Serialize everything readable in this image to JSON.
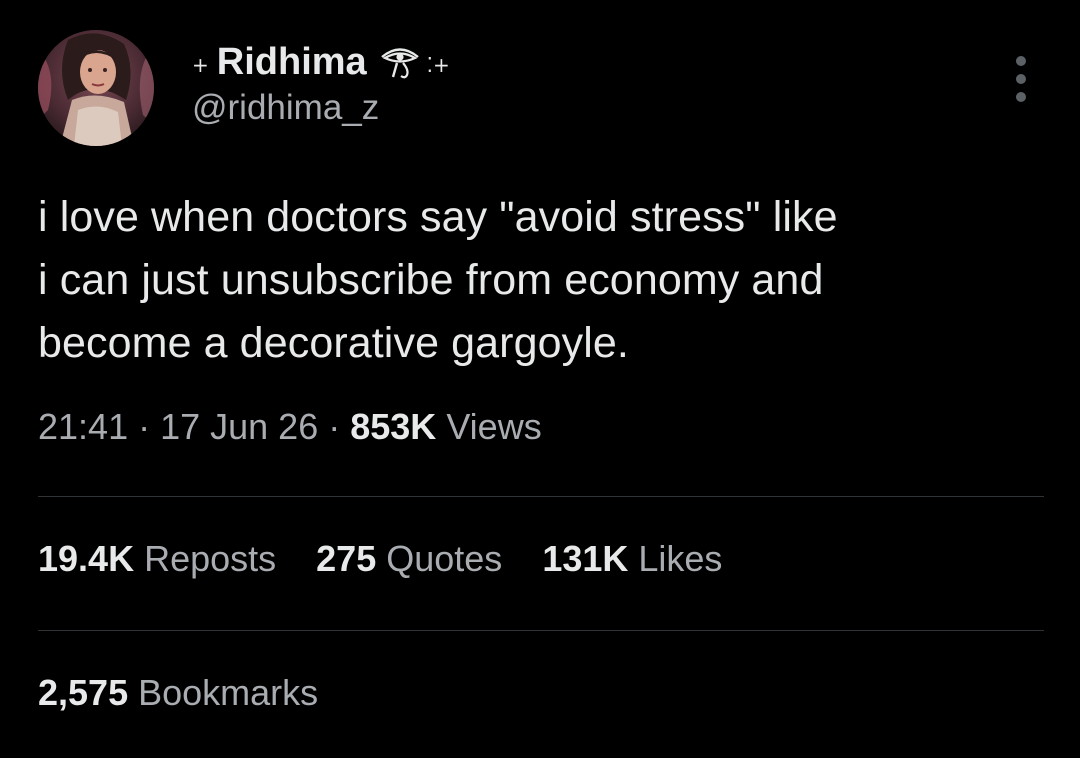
{
  "user": {
    "deco_left": "+",
    "display_name": "Ridhima",
    "deco_right": "⁚+",
    "handle": "@ridhima_z",
    "verified_icon": "eye-of-horus-icon"
  },
  "tweet": {
    "text_lines": [
      "i love when doctors say \"avoid stress\" like",
      "i can just unsubscribe from economy and",
      "become a decorative gargoyle."
    ],
    "time": "21:41",
    "date": "17 Jun 26",
    "separator": "·",
    "views_count": "853K",
    "views_label": "Views"
  },
  "stats": {
    "reposts_count": "19.4K",
    "reposts_label": "Reposts",
    "quotes_count": "275",
    "quotes_label": "Quotes",
    "likes_count": "131K",
    "likes_label": "Likes",
    "bookmarks_count": "2,575",
    "bookmarks_label": "Bookmarks"
  },
  "colors": {
    "background": "#000000",
    "primary_text": "#e7e9ea",
    "secondary_text": "#a9adb1",
    "divider": "#2f3336"
  }
}
